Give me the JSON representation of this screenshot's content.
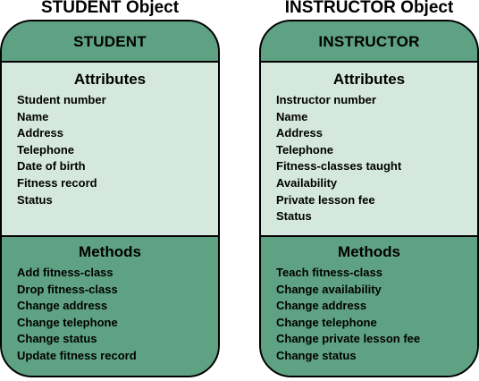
{
  "student": {
    "object_title": "STUDENT Object",
    "class_name": "STUDENT",
    "attributes_title": "Attributes",
    "attributes": [
      "Student number",
      "Name",
      "Address",
      "Telephone",
      "Date of birth",
      "Fitness record",
      "Status"
    ],
    "methods_title": "Methods",
    "methods": [
      "Add fitness-class",
      "Drop fitness-class",
      "Change address",
      "Change telephone",
      "Change status",
      "Update fitness record"
    ]
  },
  "instructor": {
    "object_title": "INSTRUCTOR Object",
    "class_name": "INSTRUCTOR",
    "attributes_title": "Attributes",
    "attributes": [
      "Instructor number",
      "Name",
      "Address",
      "Telephone",
      "Fitness-classes taught",
      "Availability",
      "Private lesson fee",
      "Status"
    ],
    "methods_title": "Methods",
    "methods": [
      "Teach fitness-class",
      "Change availability",
      "Change address",
      "Change telephone",
      "Change private lesson fee",
      "Change status"
    ]
  },
  "colors": {
    "header_fill": "#5fa283",
    "attributes_fill": "#d5e8de",
    "methods_fill": "#5fa283",
    "outline": "#000000"
  }
}
